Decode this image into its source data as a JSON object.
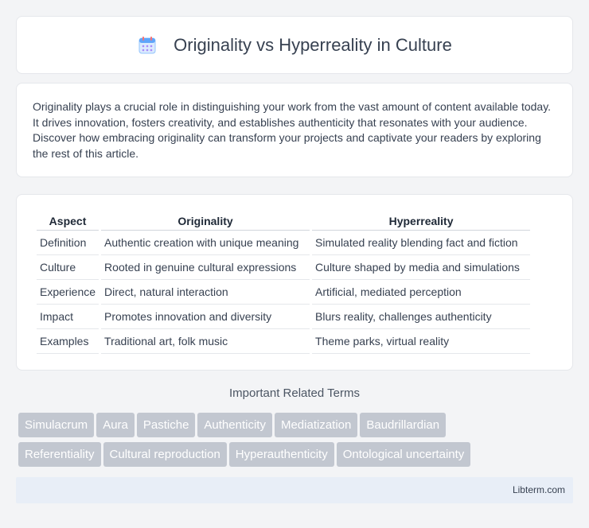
{
  "header": {
    "title": "Originality vs Hyperreality in Culture",
    "icon": "calendar-icon"
  },
  "intro": {
    "text": "Originality plays a crucial role in distinguishing your work from the vast amount of content available today. It drives innovation, fosters creativity, and establishes authenticity that resonates with your audience. Discover how embracing originality can transform your projects and captivate your readers by exploring the rest of this article."
  },
  "table": {
    "headers": [
      "Aspect",
      "Originality",
      "Hyperreality"
    ],
    "rows": [
      [
        "Definition",
        "Authentic creation with unique meaning",
        "Simulated reality blending fact and fiction"
      ],
      [
        "Culture",
        "Rooted in genuine cultural expressions",
        "Culture shaped by media and simulations"
      ],
      [
        "Experience",
        "Direct, natural interaction",
        "Artificial, mediated perception"
      ],
      [
        "Impact",
        "Promotes innovation and diversity",
        "Blurs reality, challenges authenticity"
      ],
      [
        "Examples",
        "Traditional art, folk music",
        "Theme parks, virtual reality"
      ]
    ]
  },
  "related": {
    "title": "Important Related Terms",
    "tags": [
      "Simulacrum",
      "Aura",
      "Pastiche",
      "Authenticity",
      "Mediatization",
      "Baudrillardian",
      "Referentiality",
      "Cultural reproduction",
      "Hyperauthenticity",
      "Ontological uncertainty"
    ]
  },
  "footer": {
    "text": "Libterm.com"
  },
  "colors": {
    "tag_bg": "#c2c7d0",
    "footer_bg": "#e8eef7",
    "page_bg": "#f3f4f6"
  }
}
